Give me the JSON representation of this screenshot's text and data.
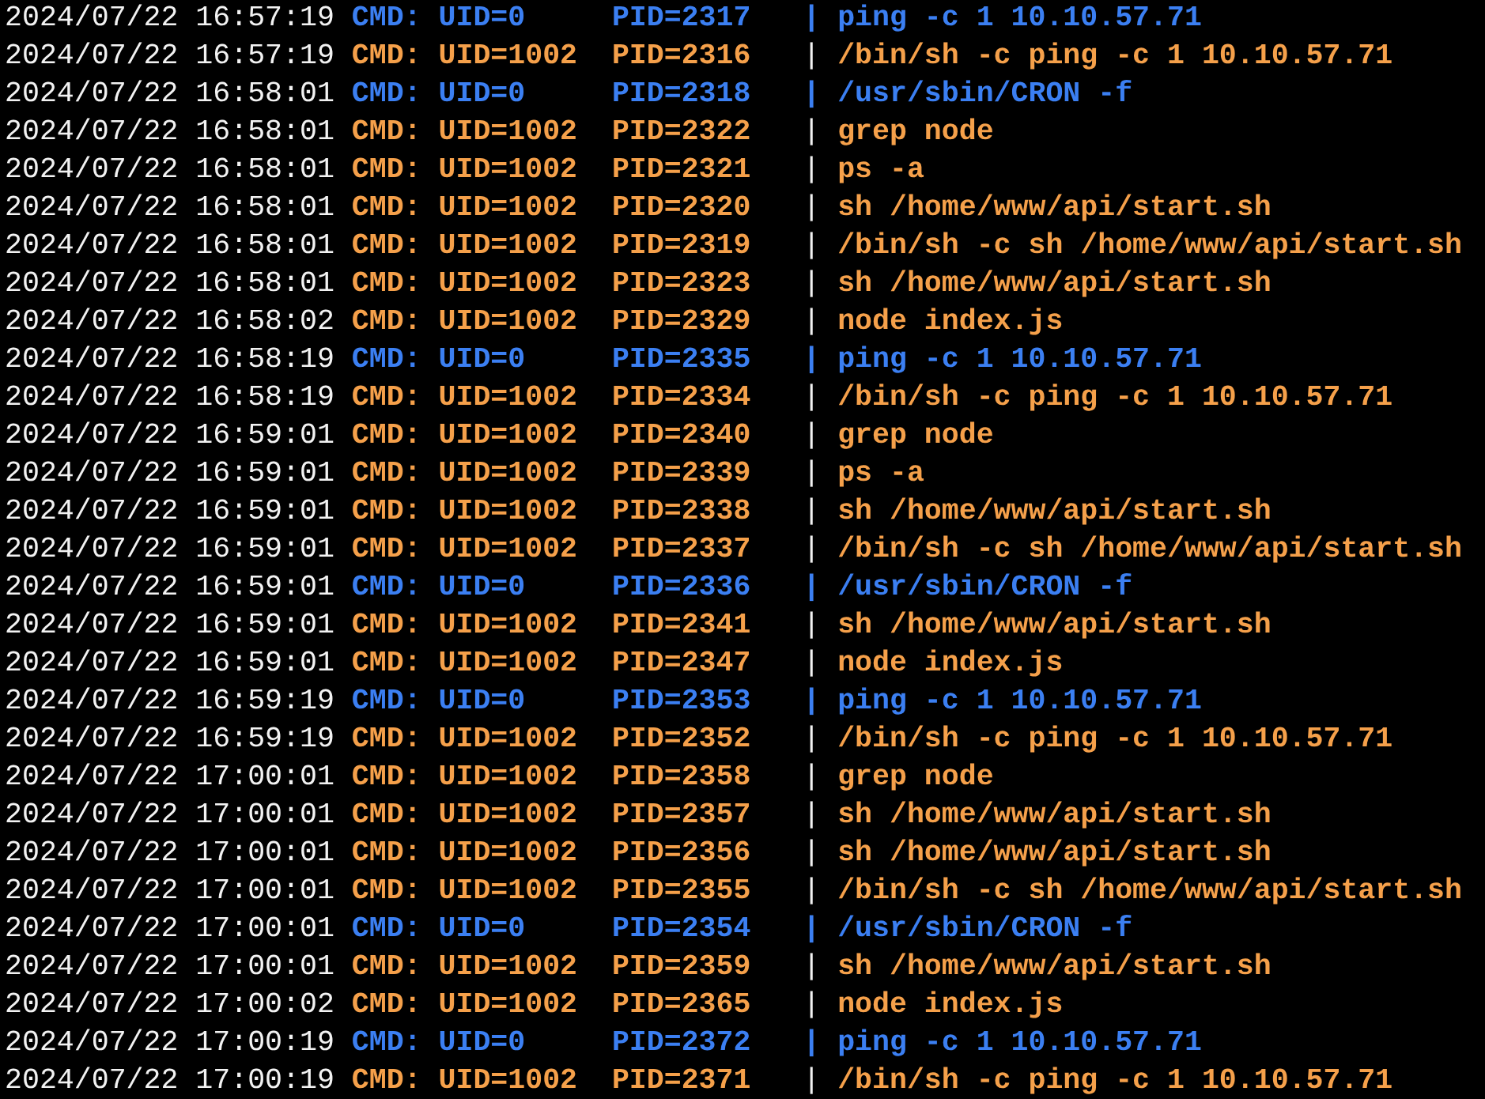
{
  "lines": [
    {
      "time": "2024/07/22 16:57:19",
      "kind": "root",
      "label": "CMD:",
      "uid": "UID=0",
      "pid": "PID=2317",
      "sep": "|",
      "command": "ping -c 1 10.10.57.71"
    },
    {
      "time": "2024/07/22 16:57:19",
      "kind": "user",
      "label": "CMD:",
      "uid": "UID=1002",
      "pid": "PID=2316",
      "sep": "|",
      "command": "/bin/sh -c ping -c 1 10.10.57.71"
    },
    {
      "time": "2024/07/22 16:58:01",
      "kind": "root",
      "label": "CMD:",
      "uid": "UID=0",
      "pid": "PID=2318",
      "sep": "|",
      "command": "/usr/sbin/CRON -f"
    },
    {
      "time": "2024/07/22 16:58:01",
      "kind": "user",
      "label": "CMD:",
      "uid": "UID=1002",
      "pid": "PID=2322",
      "sep": "|",
      "command": "grep node"
    },
    {
      "time": "2024/07/22 16:58:01",
      "kind": "user",
      "label": "CMD:",
      "uid": "UID=1002",
      "pid": "PID=2321",
      "sep": "|",
      "command": "ps -a"
    },
    {
      "time": "2024/07/22 16:58:01",
      "kind": "user",
      "label": "CMD:",
      "uid": "UID=1002",
      "pid": "PID=2320",
      "sep": "|",
      "command": "sh /home/www/api/start.sh"
    },
    {
      "time": "2024/07/22 16:58:01",
      "kind": "user",
      "label": "CMD:",
      "uid": "UID=1002",
      "pid": "PID=2319",
      "sep": "|",
      "command": "/bin/sh -c sh /home/www/api/start.sh"
    },
    {
      "time": "2024/07/22 16:58:01",
      "kind": "user",
      "label": "CMD:",
      "uid": "UID=1002",
      "pid": "PID=2323",
      "sep": "|",
      "command": "sh /home/www/api/start.sh"
    },
    {
      "time": "2024/07/22 16:58:02",
      "kind": "user",
      "label": "CMD:",
      "uid": "UID=1002",
      "pid": "PID=2329",
      "sep": "|",
      "command": "node index.js"
    },
    {
      "time": "2024/07/22 16:58:19",
      "kind": "root",
      "label": "CMD:",
      "uid": "UID=0",
      "pid": "PID=2335",
      "sep": "|",
      "command": "ping -c 1 10.10.57.71"
    },
    {
      "time": "2024/07/22 16:58:19",
      "kind": "user",
      "label": "CMD:",
      "uid": "UID=1002",
      "pid": "PID=2334",
      "sep": "|",
      "command": "/bin/sh -c ping -c 1 10.10.57.71"
    },
    {
      "time": "2024/07/22 16:59:01",
      "kind": "user",
      "label": "CMD:",
      "uid": "UID=1002",
      "pid": "PID=2340",
      "sep": "|",
      "command": "grep node"
    },
    {
      "time": "2024/07/22 16:59:01",
      "kind": "user",
      "label": "CMD:",
      "uid": "UID=1002",
      "pid": "PID=2339",
      "sep": "|",
      "command": "ps -a"
    },
    {
      "time": "2024/07/22 16:59:01",
      "kind": "user",
      "label": "CMD:",
      "uid": "UID=1002",
      "pid": "PID=2338",
      "sep": "|",
      "command": "sh /home/www/api/start.sh"
    },
    {
      "time": "2024/07/22 16:59:01",
      "kind": "user",
      "label": "CMD:",
      "uid": "UID=1002",
      "pid": "PID=2337",
      "sep": "|",
      "command": "/bin/sh -c sh /home/www/api/start.sh"
    },
    {
      "time": "2024/07/22 16:59:01",
      "kind": "root",
      "label": "CMD:",
      "uid": "UID=0",
      "pid": "PID=2336",
      "sep": "|",
      "command": "/usr/sbin/CRON -f"
    },
    {
      "time": "2024/07/22 16:59:01",
      "kind": "user",
      "label": "CMD:",
      "uid": "UID=1002",
      "pid": "PID=2341",
      "sep": "|",
      "command": "sh /home/www/api/start.sh"
    },
    {
      "time": "2024/07/22 16:59:01",
      "kind": "user",
      "label": "CMD:",
      "uid": "UID=1002",
      "pid": "PID=2347",
      "sep": "|",
      "command": "node index.js"
    },
    {
      "time": "2024/07/22 16:59:19",
      "kind": "root",
      "label": "CMD:",
      "uid": "UID=0",
      "pid": "PID=2353",
      "sep": "|",
      "command": "ping -c 1 10.10.57.71"
    },
    {
      "time": "2024/07/22 16:59:19",
      "kind": "user",
      "label": "CMD:",
      "uid": "UID=1002",
      "pid": "PID=2352",
      "sep": "|",
      "command": "/bin/sh -c ping -c 1 10.10.57.71"
    },
    {
      "time": "2024/07/22 17:00:01",
      "kind": "user",
      "label": "CMD:",
      "uid": "UID=1002",
      "pid": "PID=2358",
      "sep": "|",
      "command": "grep node"
    },
    {
      "time": "2024/07/22 17:00:01",
      "kind": "user",
      "label": "CMD:",
      "uid": "UID=1002",
      "pid": "PID=2357",
      "sep": "|",
      "command": "sh /home/www/api/start.sh"
    },
    {
      "time": "2024/07/22 17:00:01",
      "kind": "user",
      "label": "CMD:",
      "uid": "UID=1002",
      "pid": "PID=2356",
      "sep": "|",
      "command": "sh /home/www/api/start.sh"
    },
    {
      "time": "2024/07/22 17:00:01",
      "kind": "user",
      "label": "CMD:",
      "uid": "UID=1002",
      "pid": "PID=2355",
      "sep": "|",
      "command": "/bin/sh -c sh /home/www/api/start.sh"
    },
    {
      "time": "2024/07/22 17:00:01",
      "kind": "root",
      "label": "CMD:",
      "uid": "UID=0",
      "pid": "PID=2354",
      "sep": "|",
      "command": "/usr/sbin/CRON -f"
    },
    {
      "time": "2024/07/22 17:00:01",
      "kind": "user",
      "label": "CMD:",
      "uid": "UID=1002",
      "pid": "PID=2359",
      "sep": "|",
      "command": "sh /home/www/api/start.sh"
    },
    {
      "time": "2024/07/22 17:00:02",
      "kind": "user",
      "label": "CMD:",
      "uid": "UID=1002",
      "pid": "PID=2365",
      "sep": "|",
      "command": "node index.js"
    },
    {
      "time": "2024/07/22 17:00:19",
      "kind": "root",
      "label": "CMD:",
      "uid": "UID=0",
      "pid": "PID=2372",
      "sep": "|",
      "command": "ping -c 1 10.10.57.71"
    },
    {
      "time": "2024/07/22 17:00:19",
      "kind": "user",
      "label": "CMD:",
      "uid": "UID=1002",
      "pid": "PID=2371",
      "sep": "|",
      "command": "/bin/sh -c ping -c 1 10.10.57.71"
    }
  ]
}
